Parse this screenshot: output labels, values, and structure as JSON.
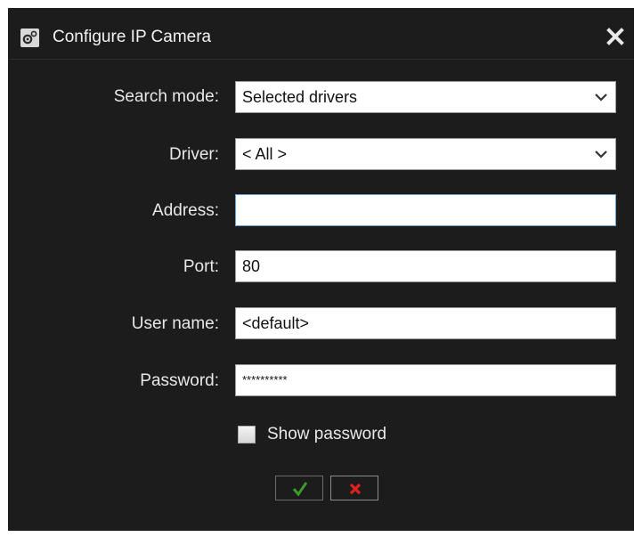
{
  "window": {
    "title": "Configure IP Camera",
    "icon": "camera-settings-icon",
    "close_icon": "close-icon"
  },
  "form": {
    "search_mode": {
      "label": "Search mode:",
      "value": "Selected drivers"
    },
    "driver": {
      "label": "Driver:",
      "value": "< All >"
    },
    "address": {
      "label": "Address:",
      "value": ""
    },
    "port": {
      "label": "Port:",
      "value": "80"
    },
    "user_name": {
      "label": "User name:",
      "value": "<default>"
    },
    "password": {
      "label": "Password:",
      "value": "**********"
    },
    "show_password": {
      "label": "Show password",
      "checked": false
    }
  },
  "buttons": {
    "ok_icon": "checkmark-icon",
    "cancel_icon": "x-icon"
  },
  "colors": {
    "background": "#1c1c1c",
    "text": "#e8e8e8",
    "ok_green": "#3c9a2a",
    "cancel_red": "#e02020",
    "focus_border": "#6a9fd0"
  }
}
